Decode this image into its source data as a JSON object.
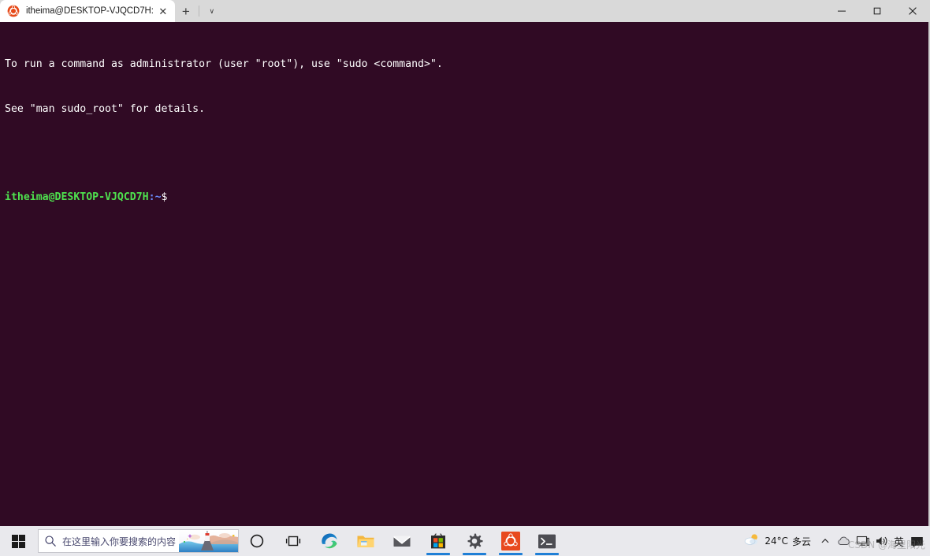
{
  "window": {
    "tab": {
      "title": "itheima@DESKTOP-VJQCD7H:",
      "favicon_name": "ubuntu-logo-icon",
      "close_label": "✕"
    },
    "new_tab_label": "+",
    "tab_dropdown_label": "∨",
    "controls": {
      "minimize_label": "─",
      "maximize_label": "❐",
      "close_label": "✕"
    }
  },
  "terminal": {
    "colors": {
      "background": "#300a24",
      "foreground": "#ffffff",
      "user_host": "#4ee24e",
      "path": "#6a8cff"
    },
    "lines": [
      "To run a command as administrator (user \"root\"), use \"sudo <command>\".",
      "See \"man sudo_root\" for details."
    ],
    "prompt": {
      "user_host": "itheima@DESKTOP-VJQCD7H",
      "separator": ":",
      "path": "~",
      "symbol": "$"
    }
  },
  "taskbar": {
    "start_name": "windows-start-button",
    "search": {
      "placeholder": "在这里输入你要搜索的内容",
      "value": ""
    },
    "items": [
      {
        "name": "cortana-icon",
        "label": "Cortana",
        "running": false
      },
      {
        "name": "task-view-icon",
        "label": "任务视图",
        "running": false
      },
      {
        "name": "microsoft-edge-icon",
        "label": "Microsoft Edge",
        "running": false
      },
      {
        "name": "file-explorer-icon",
        "label": "文件资源管理器",
        "running": false
      },
      {
        "name": "mail-icon",
        "label": "邮件",
        "running": false
      },
      {
        "name": "microsoft-store-icon",
        "label": "Microsoft Store",
        "running": true
      },
      {
        "name": "settings-gear-icon",
        "label": "设置",
        "running": true
      },
      {
        "name": "ubuntu-icon",
        "label": "Ubuntu",
        "running": true
      },
      {
        "name": "windows-terminal-icon",
        "label": "Windows Terminal",
        "running": true
      }
    ],
    "tray": {
      "weather": {
        "icon_name": "sun-behind-cloud-icon",
        "temperature": "24°C",
        "condition": "多云"
      },
      "show_hidden_label": "∧",
      "icons": [
        {
          "name": "onedrive-cloud-icon"
        },
        {
          "name": "network-monitor-icon"
        },
        {
          "name": "volume-speaker-icon"
        }
      ],
      "ime_label": "英",
      "notification_name": "action-center-icon"
    },
    "watermark": "CSDN @海里阳光"
  }
}
